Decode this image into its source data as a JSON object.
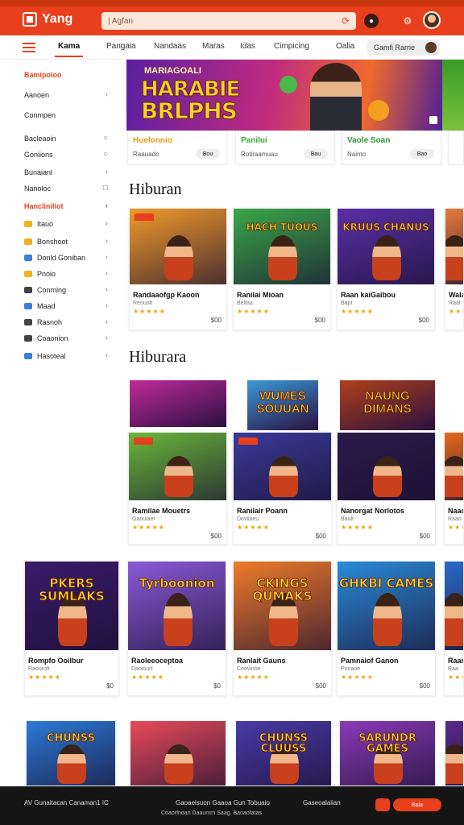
{
  "header": {
    "app_name": "Yang",
    "search_placeholder": "| Agfan",
    "icons": [
      "notification-icon",
      "settings-icon",
      "profile-avatar"
    ]
  },
  "tabs": {
    "items": [
      "Kama",
      "Pangaia",
      "Nandaas",
      "Maras",
      "Idas",
      "Cimpicing",
      "Oalia"
    ],
    "active": "Kama",
    "pill_label": "Gamfi Rarrie"
  },
  "sidebar": {
    "items": [
      {
        "label": "Bamipoloo",
        "head": true,
        "chev": ""
      },
      {
        "label": "Aanoen",
        "chev": "›"
      },
      {
        "label": "Conmpen",
        "chev": ""
      },
      {
        "label": "Bacleaoin",
        "chev": "○"
      },
      {
        "label": "Goniions",
        "chev": "○"
      },
      {
        "label": "Bunaianl",
        "chev": "›"
      },
      {
        "label": "Nanoloc",
        "chev": "□"
      },
      {
        "label": "Hancliniliot",
        "head": true,
        "chev": "›"
      },
      {
        "label": "Itauo",
        "chev": "›",
        "color": "#f0b020"
      },
      {
        "label": "Bonshoot",
        "chev": "›",
        "color": "#f0b020"
      },
      {
        "label": "Donld Goniban",
        "chev": "›",
        "color": "#3a7fd8"
      },
      {
        "label": "Pnoio",
        "chev": "›",
        "color": "#f0b020"
      },
      {
        "label": "Conming",
        "chev": "›",
        "color": "#444444"
      },
      {
        "label": "Maad",
        "chev": "›",
        "color": "#3a7fd8"
      },
      {
        "label": "Rasnoh",
        "chev": "›",
        "color": "#444444"
      },
      {
        "label": "Coaonion",
        "chev": "›",
        "color": "#444444"
      },
      {
        "label": "Hasoteal",
        "chev": "›",
        "color": "#3a7fd8"
      }
    ]
  },
  "banner": {
    "title_line1": "HARABIE",
    "title_line2": "BRLPHS",
    "subtitle": "MARIAGOALI"
  },
  "promos": [
    {
      "title": "Huelonnio",
      "sub": "Raauado",
      "btn": "Bou",
      "color": "#e0a018"
    },
    {
      "title": "Panilui",
      "sub": "Rotiraamuau",
      "btn": "Bau",
      "color": "#3aa83a"
    },
    {
      "title": "Vaole Soan",
      "sub": "Naimo",
      "btn": "Bao",
      "color": "#2e9a3a"
    }
  ],
  "sections": [
    {
      "title": "Hiburan"
    },
    {
      "title": "Hiburara"
    }
  ],
  "row1": [
    {
      "name": "Randaaofgp Kaoon",
      "sub": "Reouolt",
      "price": "$00",
      "thumb_title": "",
      "bg": "#f29a2a"
    },
    {
      "name": "Ranilai Mioan",
      "sub": "Beltaa",
      "price": "$00",
      "thumb_title": "HACH TUOUS",
      "bg": "#3aa64a"
    },
    {
      "name": "Raan kaiGaibou",
      "sub": "Bapt",
      "price": "$00",
      "thumb_title": "KRUUS CHANUS",
      "bg": "#5a2fa8"
    },
    {
      "name": "Wala",
      "sub": "Raal",
      "price": "",
      "thumb_title": "",
      "bg": "#e87a3a"
    }
  ],
  "row2_banners": [
    {
      "title": "",
      "bg": "#c02a9a"
    },
    {
      "title": "WUMES SOUUAN",
      "bg": "#3a9ad8"
    },
    {
      "title": "NAUNG DIMANS",
      "bg": "#b0401a"
    }
  ],
  "row2": [
    {
      "name": "Ramilae Mouetrs",
      "sub": "Ganuiaer",
      "price": "$00",
      "bg": "#6ab83a"
    },
    {
      "name": "Ranilair Poann",
      "sub": "Doviiaeu",
      "price": "$00",
      "bg": "#3a3a9a"
    },
    {
      "name": "Nanorgat Norlotos",
      "sub": "Bault",
      "price": "$00",
      "bg": "#2a1a4a"
    },
    {
      "name": "Naao",
      "sub": "Raao",
      "price": "",
      "bg": "#e86a1a"
    }
  ],
  "row3": [
    {
      "name": "Rompfo Ooilbur",
      "sub": "Raourolt",
      "price": "$0",
      "thumb_title": "PKERS SUMLAKS",
      "bg": "#3a1a6a"
    },
    {
      "name": "Raoleeoceptoa",
      "sub": "Daoiourt",
      "price": "$0",
      "thumb_title": "Tyrboonion",
      "bg": "#8a5ad8"
    },
    {
      "name": "Ranlait Gauns",
      "sub": "Ceevinoe",
      "price": "$00",
      "thumb_title": "CKINGS QUMAKS",
      "bg": "#f07a2a"
    },
    {
      "name": "Pamnaiof Ganon",
      "sub": "Ponaoe",
      "price": "$00",
      "thumb_title": "GHKBI CAMES",
      "bg": "#2a8ad8"
    },
    {
      "name": "Raan",
      "sub": "Raa",
      "price": "",
      "thumb_title": "",
      "bg": "#2a6ac8"
    }
  ],
  "row4": [
    {
      "thumb_title": "CHUNSS",
      "bg": "#2a7ad8"
    },
    {
      "thumb_title": "",
      "bg": "#e84a5a"
    },
    {
      "thumb_title": "CHUNSS CLUUSS",
      "bg": "#4a3aa8"
    },
    {
      "thumb_title": "SARUNDR GAMES",
      "bg": "#8a3ab8"
    },
    {
      "thumb_title": "",
      "bg": "#5a2a8a"
    }
  ],
  "stars": "★★★★★",
  "footer": {
    "left": "AV Gunaitacan Canaman1 IC",
    "mid": "Gaoaeisuon Gaaoa Gun Tobuaio",
    "mid2": "Coaorfnoan Daaumrn Saag. Baoaofatas",
    "right": "Gaseoalaiian",
    "btn": "Bala"
  }
}
